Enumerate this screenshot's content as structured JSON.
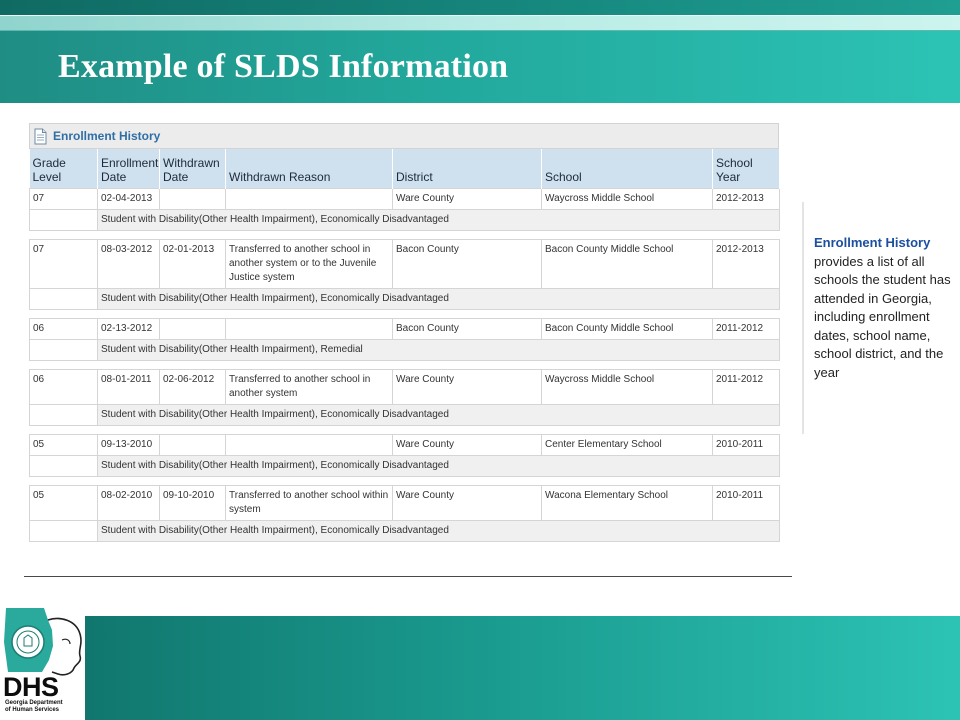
{
  "slide": {
    "title": "Example of SLDS Information"
  },
  "panel": {
    "title": "Enrollment History",
    "icon": "document-icon"
  },
  "table": {
    "headers": [
      "Grade Level",
      "Enrollment Date",
      "Withdrawn Date",
      "Withdrawn Reason",
      "District",
      "School",
      "School Year"
    ],
    "records": [
      {
        "grade": "07",
        "enrollment": "02-04-2013",
        "withdrawn": "",
        "reason": "",
        "district": "Ware County",
        "school": "Waycross Middle School",
        "year": "2012-2013",
        "notes": "Student with Disability(Other Health Impairment), Economically Disadvantaged"
      },
      {
        "grade": "07",
        "enrollment": "08-03-2012",
        "withdrawn": "02-01-2013",
        "reason": "Transferred to another school in another system or to the Juvenile Justice system",
        "district": "Bacon County",
        "school": "Bacon County Middle School",
        "year": "2012-2013",
        "notes": "Student with Disability(Other Health Impairment), Economically Disadvantaged"
      },
      {
        "grade": "06",
        "enrollment": "02-13-2012",
        "withdrawn": "",
        "reason": "",
        "district": "Bacon County",
        "school": "Bacon County Middle School",
        "year": "2011-2012",
        "notes": "Student with Disability(Other Health Impairment), Remedial"
      },
      {
        "grade": "06",
        "enrollment": "08-01-2011",
        "withdrawn": "02-06-2012",
        "reason": "Transferred to another school in another system",
        "district": "Ware County",
        "school": "Waycross Middle School",
        "year": "2011-2012",
        "notes": "Student with Disability(Other Health Impairment), Economically Disadvantaged"
      },
      {
        "grade": "05",
        "enrollment": "09-13-2010",
        "withdrawn": "",
        "reason": "",
        "district": "Ware County",
        "school": "Center Elementary School",
        "year": "2010-2011",
        "notes": "Student with Disability(Other Health Impairment), Economically Disadvantaged"
      },
      {
        "grade": "05",
        "enrollment": "08-02-2010",
        "withdrawn": "09-10-2010",
        "reason": "Transferred to another school within system",
        "district": "Ware County",
        "school": "Wacona Elementary School",
        "year": "2010-2011",
        "notes": "Student with Disability(Other Health Impairment), Economically Disadvantaged"
      }
    ]
  },
  "side_note": {
    "highlight": "Enrollment History",
    "text": "provides a list of all schools the student has attended in Georgia, including enrollment dates, school name, school district, and the year"
  },
  "logo": {
    "wordmark": "DHS",
    "subtitle": "Georgia Department of Human Services"
  },
  "colors": {
    "teal_dark": "#0f6f67",
    "teal_light": "#2cc3b5",
    "header_blue": "#cfe0ee",
    "title_blue": "#2f6ea6",
    "note_blue": "#1b4fa0"
  }
}
